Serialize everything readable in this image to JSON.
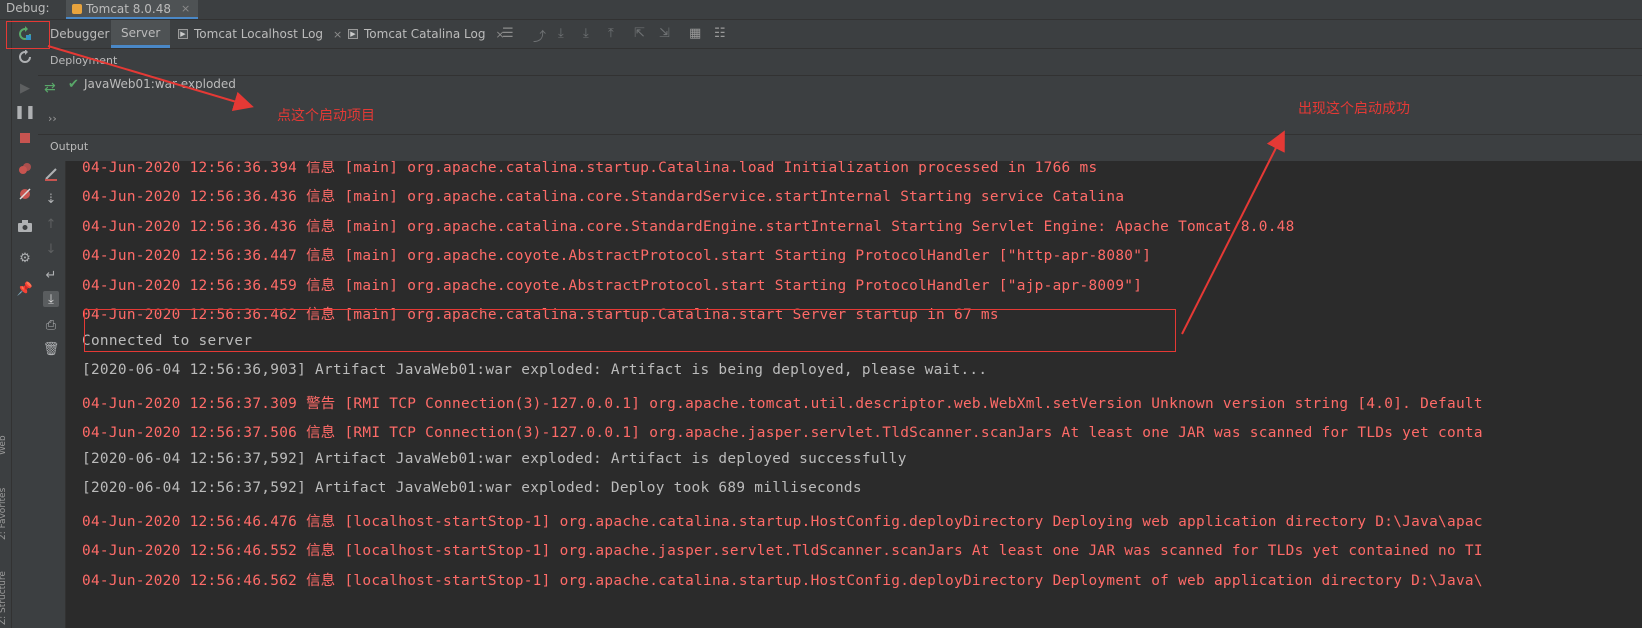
{
  "window": {
    "debug_label": "Debug:",
    "run_config_tab": "Tomcat 8.0.48",
    "close_glyph": "×"
  },
  "tabs": [
    {
      "label": "Debugger"
    },
    {
      "label": "Server"
    },
    {
      "label": "Tomcat Localhost Log"
    },
    {
      "label": "Tomcat Catalina Log"
    }
  ],
  "deployment": {
    "title": "Deployment",
    "artifact": "JavaWeb01:war exploded",
    "expand_glyph": "››"
  },
  "output": {
    "title": "Output"
  },
  "left_strip": {
    "web": "Web",
    "favorites": "2: Favorites",
    "structure": "Z: Structure"
  },
  "annotations": {
    "start_hint": "点这个启动项目",
    "success_hint": "出现这个启动成功"
  },
  "colors": {
    "error_text": "#ff6b68",
    "annotation_red": "#e53935",
    "console_bg": "#2b2b2b",
    "panel_bg": "#3c3f41",
    "accent_blue": "#4a88c7"
  },
  "console_lines": [
    {
      "text": "04-Jun-2020 12:56:36.394 信息 [main] org.apache.catalina.startup.Catalina.load Initialization processed in 1766 ms",
      "style": "red"
    },
    {
      "text": "04-Jun-2020 12:56:36.436 信息 [main] org.apache.catalina.core.StandardService.startInternal Starting service Catalina",
      "style": "red"
    },
    {
      "text": "04-Jun-2020 12:56:36.436 信息 [main] org.apache.catalina.core.StandardEngine.startInternal Starting Servlet Engine: Apache Tomcat/8.0.48",
      "style": "red"
    },
    {
      "text": "04-Jun-2020 12:56:36.447 信息 [main] org.apache.coyote.AbstractProtocol.start Starting ProtocolHandler [\"http-apr-8080\"]",
      "style": "red"
    },
    {
      "text": "04-Jun-2020 12:56:36.459 信息 [main] org.apache.coyote.AbstractProtocol.start Starting ProtocolHandler [\"ajp-apr-8009\"]",
      "style": "red"
    },
    {
      "text": "04-Jun-2020 12:56:36.462 信息 [main] org.apache.catalina.startup.Catalina.start Server startup in 67 ms",
      "style": "red"
    },
    {
      "text": "Connected to server",
      "style": "plain"
    },
    {
      "text": "[2020-06-04 12:56:36,903] Artifact JavaWeb01:war exploded: Artifact is being deployed, please wait...",
      "style": "plain"
    },
    {
      "text": "04-Jun-2020 12:56:37.309 警告 [RMI TCP Connection(3)-127.0.0.1] org.apache.tomcat.util.descriptor.web.WebXml.setVersion Unknown version string [4.0]. Default",
      "style": "red"
    },
    {
      "text": "04-Jun-2020 12:56:37.506 信息 [RMI TCP Connection(3)-127.0.0.1] org.apache.jasper.servlet.TldScanner.scanJars At least one JAR was scanned for TLDs yet conta",
      "style": "red"
    },
    {
      "text": "[2020-06-04 12:56:37,592] Artifact JavaWeb01:war exploded: Artifact is deployed successfully",
      "style": "plain"
    },
    {
      "text": "[2020-06-04 12:56:37,592] Artifact JavaWeb01:war exploded: Deploy took 689 milliseconds",
      "style": "plain"
    },
    {
      "text": "04-Jun-2020 12:56:46.476 信息 [localhost-startStop-1] org.apache.catalina.startup.HostConfig.deployDirectory Deploying web application directory D:\\Java\\apac",
      "style": "red"
    },
    {
      "text": "04-Jun-2020 12:56:46.552 信息 [localhost-startStop-1] org.apache.jasper.servlet.TldScanner.scanJars At least one JAR was scanned for TLDs yet contained no TI",
      "style": "red"
    },
    {
      "text": "04-Jun-2020 12:56:46.562 信息 [localhost-startStop-1] org.apache.catalina.startup.HostConfig.deployDirectory Deployment of web application directory D:\\Java\\",
      "style": "red"
    }
  ]
}
